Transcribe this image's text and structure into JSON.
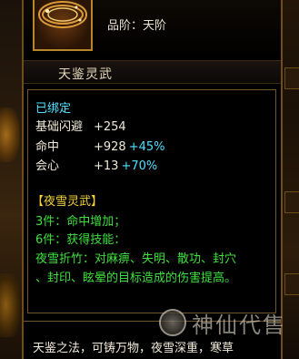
{
  "item": {
    "grade_label": "品阶：天阶",
    "name": "天鉴灵武"
  },
  "details": {
    "bound": "已绑定",
    "stats": [
      {
        "label": "基础闪避",
        "value": "+254",
        "pct": ""
      },
      {
        "label": "命中",
        "value": "+928",
        "pct": "+45%"
      },
      {
        "label": "会心",
        "value": "+13",
        "pct": "+70%"
      }
    ],
    "set": {
      "name": "【夜雪灵武】",
      "bonuses": [
        "3件：命中增加；",
        "6件：获得技能：",
        "夜雪折竹：对麻痹、失明、散功、封穴",
        "、封印、眩晕的目标造成的伤害提高。"
      ]
    }
  },
  "lore": "天鉴之法，可铸万物，夜雪深重，寒草",
  "watermark": {
    "text": "神仙代售"
  },
  "colors": {
    "stat_pct": "#50e0ff",
    "set_name": "#f2d23a",
    "set_bonus": "#3fe03f",
    "border": "#6e4c1c"
  }
}
